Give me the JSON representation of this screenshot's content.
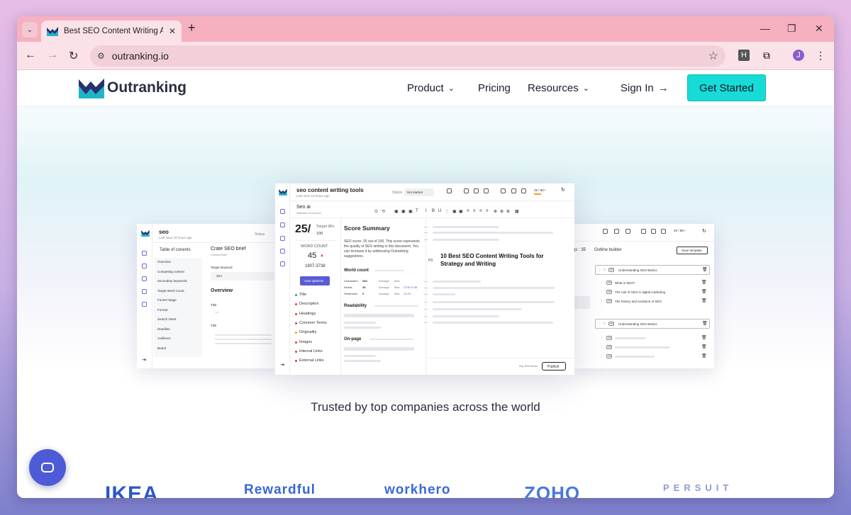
{
  "browser": {
    "tab_title": "Best SEO Content Writing AI So",
    "url": "outranking.io",
    "ext_h_label": "H",
    "avatar_letter": "J"
  },
  "site": {
    "logo_text": "Outranking",
    "nav": {
      "product": "Product",
      "pricing": "Pricing",
      "resources": "Resources",
      "signin": "Sign In"
    },
    "cta": "Get Started",
    "trusted": "Trusted by top companies across the world",
    "brands": [
      "IKEA",
      "Rewardful",
      "workhero",
      "ZOHO",
      "PERSUIT"
    ]
  },
  "left_shot": {
    "title": "seo",
    "subtitle": "Last save 19 hours ago",
    "status": "Status",
    "toc": "Table of conents",
    "items": [
      "Overview",
      "Competing content",
      "Secondary keywords",
      "Target Word Count",
      "Funnel Stage",
      "Format",
      "Search intent",
      "Deadline",
      "Audience",
      "Brand"
    ],
    "brief_title": "Crate SEO brief",
    "brief_sub": "Content Brief",
    "target_keyword": "Target keyword",
    "keyword_value": "Seo",
    "overview": "Overview",
    "title_label": "Title",
    "title_label2": "Title"
  },
  "main_shot": {
    "title": "seo content writing tools",
    "subtitle": "Last save 19 hours ago",
    "status": "Status",
    "status_value": "Not started",
    "score_range": "25 / 86+",
    "seo_ai": "Seo ai",
    "seo_ai_sub": "Statistics and score",
    "score": "25/",
    "target": "Target 86+",
    "target_val": "100",
    "word_count_label": "WORD COUNT",
    "word_count": "45",
    "word_range": "1807-3738",
    "auto_btn": "Auto optimize",
    "checks": [
      {
        "label": "Title",
        "color": "#22b04b"
      },
      {
        "label": "Description",
        "color": "#e23b3b"
      },
      {
        "label": "Headings",
        "color": "#e23b3b"
      },
      {
        "label": "Common Terms",
        "color": "#e23b3b"
      },
      {
        "label": "Originality",
        "color": "#f0a020"
      },
      {
        "label": "Images",
        "color": "#e23b3b"
      },
      {
        "label": "Internal Links",
        "color": "#e23b3b"
      },
      {
        "label": "External Links",
        "color": "#e23b3b"
      }
    ],
    "summary_title": "Score Summary",
    "summary_text": "SEO score: 25 out of 100. This score represents the quality of SEO writing in this document. You can increase it by addressing Outranking suggestions.",
    "world_count": "World count",
    "stats": [
      {
        "k": "Characters",
        "v": "283",
        "a": "Average",
        "m": "Max"
      },
      {
        "k": "Words",
        "v": "45",
        "a": "Average",
        "m": "Max",
        "r": "2708-3738"
      },
      {
        "k": "Sentences",
        "v": "0",
        "a": "Average",
        "m": "Max",
        "r": "13-24"
      }
    ],
    "readability": "Readability",
    "onpage": "On-page",
    "h1": "H1",
    "doc_heading": "10 Best SEO Content Writing Tools for Strategy and Writing",
    "footer_words": "Avg 3209 Words",
    "publish": "Publish"
  },
  "right_shot": {
    "score_range": "25 / 86+",
    "gs": "gs : 35",
    "outline_builder": "Outline builder",
    "save_template": "Save template",
    "h2a": "Understanding SEO Basics",
    "h3": [
      "What is SEO?",
      "The role of SEO in digital marketing",
      "The history and evolution of SEO"
    ],
    "h2b": "Understanding SEO Basics",
    "h2_tag": "H2",
    "h3_tag": "H3"
  },
  "colors": {
    "accent": "#17dbd6",
    "brand_purple": "#5b5bd6",
    "tabbar": "#f6b0c0"
  }
}
